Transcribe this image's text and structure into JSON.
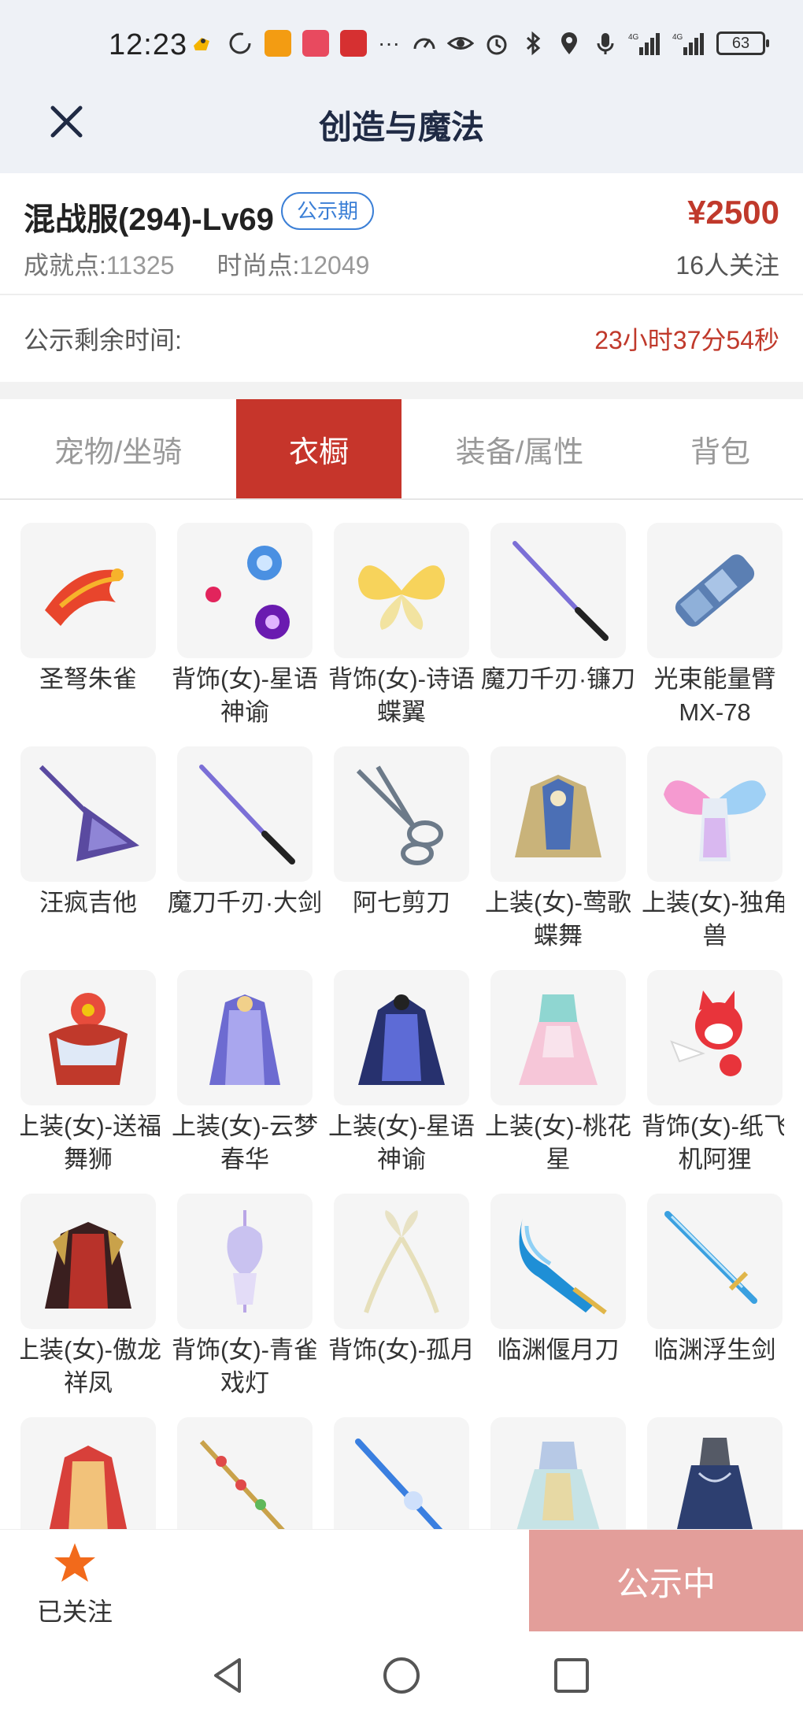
{
  "status_bar": {
    "time": "12:23",
    "more": "···",
    "battery": "63"
  },
  "header": {
    "title": "创造与魔法"
  },
  "listing": {
    "server": "混战服(294)-Lv69",
    "badge": "公示期",
    "price": "¥2500",
    "achievement_label": "成就点:",
    "achievement_value": "11325",
    "fashion_label": "时尚点:",
    "fashion_value": "12049",
    "followers": "16人关注",
    "timer_label": "公示剩余时间:",
    "timer_value": "23小时37分54秒"
  },
  "tabs": [
    {
      "label": "宠物/坐骑",
      "active": false
    },
    {
      "label": "衣橱",
      "active": true
    },
    {
      "label": "装备/属性",
      "active": false
    },
    {
      "label": "背包",
      "active": false
    }
  ],
  "items": [
    {
      "name": "圣弩朱雀",
      "icon": "phoenix-icon"
    },
    {
      "name": "背饰(女)-星语神谕",
      "icon": "orbs-icon"
    },
    {
      "name": "背饰(女)-诗语蝶翼",
      "icon": "butterfly-wings-icon"
    },
    {
      "name": "魔刀千刃·镰刀",
      "icon": "katana-icon"
    },
    {
      "name": "光束能量臂MX-78",
      "icon": "cannon-arm-icon"
    },
    {
      "name": "汪疯吉他",
      "icon": "guitar-icon"
    },
    {
      "name": "魔刀千刃·大剑",
      "icon": "katana-icon"
    },
    {
      "name": "阿七剪刀",
      "icon": "scissors-icon"
    },
    {
      "name": "上装(女)-莺歌蝶舞",
      "icon": "outfit-icon"
    },
    {
      "name": "上装(女)-独角兽",
      "icon": "rainbow-wings-icon"
    },
    {
      "name": "上装(女)-送福舞狮",
      "icon": "outfit-icon"
    },
    {
      "name": "上装(女)-云梦春华",
      "icon": "outfit-icon"
    },
    {
      "name": "上装(女)-星语神谕",
      "icon": "outfit-icon"
    },
    {
      "name": "上装(女)-桃花星",
      "icon": "outfit-icon"
    },
    {
      "name": "背饰(女)-纸飞机阿狸",
      "icon": "fox-icon"
    },
    {
      "name": "上装(女)-傲龙祥凤",
      "icon": "outfit-icon"
    },
    {
      "name": "背饰(女)-青雀戏灯",
      "icon": "lantern-icon"
    },
    {
      "name": "背饰(女)-孤月",
      "icon": "ribbon-icon"
    },
    {
      "name": "临渊偃月刀",
      "icon": "blade-icon"
    },
    {
      "name": "临渊浮生剑",
      "icon": "sword-icon"
    },
    {
      "name": "",
      "icon": "outfit-icon"
    },
    {
      "name": "",
      "icon": "staff-icon"
    },
    {
      "name": "",
      "icon": "sword-icon"
    },
    {
      "name": "",
      "icon": "outfit-icon"
    },
    {
      "name": "",
      "icon": "outfit-icon"
    }
  ],
  "bottom": {
    "follow_label": "已关注",
    "action_label": "公示中"
  },
  "colors": {
    "accent_red": "#c6352b",
    "price_red": "#c0392b",
    "badge_blue": "#3b7fd6",
    "button_disabled": "#e39e9a",
    "star_orange": "#f26a1b"
  }
}
